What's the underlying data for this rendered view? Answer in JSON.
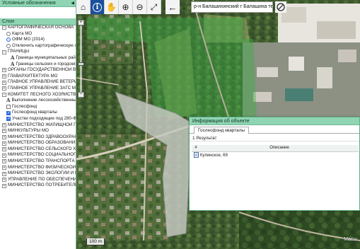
{
  "left_panel": {
    "title": "Условные обозначения",
    "layers_title": "Слои",
    "tree": [
      {
        "type": "group",
        "expand": "−",
        "label": "КАРТОГРАФИЧЕСКАЯ ОСНОВА",
        "indent": 1
      },
      {
        "type": "radio",
        "checked": false,
        "label": "Карта МО",
        "indent": 2
      },
      {
        "type": "radio",
        "checked": true,
        "label": "ОФМ МО (2014)",
        "indent": 2
      },
      {
        "type": "radio",
        "checked": false,
        "label": "Отключить картографическую осно",
        "indent": 2
      },
      {
        "type": "group",
        "expand": "−",
        "label": "ГРАНИЦЫ",
        "indent": 1
      },
      {
        "type": "legend",
        "label": "Границы муниципальных районо",
        "indent": 3
      },
      {
        "type": "legend",
        "label": "Границы сельских и городских по",
        "indent": 3
      },
      {
        "type": "group",
        "expand": "+",
        "label": "ОРГАНЫ ГОСУДАРСТВЕННОЙ ВЛАСТИ М",
        "indent": 1
      },
      {
        "type": "group",
        "expand": "+",
        "label": "ГЛАВАРХИТЕКТУРА МО",
        "indent": 1
      },
      {
        "type": "group",
        "expand": "+",
        "label": "ГЛАВНОЕ УПРАВЛЕНИЕ ВЕТЕРИНАРИИ",
        "indent": 1
      },
      {
        "type": "group",
        "expand": "+",
        "label": "ГЛАВНОЕ УПРАВЛЕНИЕ ЗАГС МО",
        "indent": 1
      },
      {
        "type": "group",
        "expand": "−",
        "label": "КОМИТЕТ ЛЕСНОГО ХОЗЯЙСТВА МО",
        "indent": 1
      },
      {
        "type": "legend",
        "label": "Выполнение лесохозяйственных",
        "indent": 2
      },
      {
        "type": "check",
        "checked": false,
        "label": "Гослесфонд",
        "indent": 2
      },
      {
        "type": "check",
        "checked": true,
        "label": "Гослесфонд кварталы",
        "indent": 2
      },
      {
        "type": "check",
        "checked": true,
        "label": "Участки подходящие под 280-ФЗ",
        "indent": 2
      },
      {
        "type": "group",
        "expand": "+",
        "label": "МИНИСТЕРСТВО ЖИЛИЩНОЙ ПОЛИТИКИ",
        "indent": 1
      },
      {
        "type": "group",
        "expand": "+",
        "label": "МИНКУЛЬТУРЫ МО",
        "indent": 1
      },
      {
        "type": "group",
        "expand": "+",
        "label": "МИНИСТЕРСТВО ЗДРАВООХРАНЕНИЯ М",
        "indent": 1
      },
      {
        "type": "group",
        "expand": "+",
        "label": "МИНИСТЕРСТВО ОБРАЗОВАНИЯ МО",
        "indent": 1
      },
      {
        "type": "group",
        "expand": "+",
        "label": "МИНИСТЕРСТВО СЕЛЬСКОГО ХОЗЯЙСТ",
        "indent": 1
      },
      {
        "type": "group",
        "expand": "+",
        "label": "МИНИСТЕРСТВО СОЦИАЛЬНОГО РАЗВИ",
        "indent": 1
      },
      {
        "type": "group",
        "expand": "+",
        "label": "МИНИСТЕРСТВО ТРАНСПОРТА И ДОРОЖ",
        "indent": 1
      },
      {
        "type": "group",
        "expand": "+",
        "label": "МИНИСТЕРСТВО ФИЗИЧЕСКОЙ КУЛЬТУ",
        "indent": 1
      },
      {
        "type": "group",
        "expand": "+",
        "label": "МИНИСТЕРСТВО ЭКОЛОГИИ И ПРИРОДО",
        "indent": 1
      },
      {
        "type": "group",
        "expand": "+",
        "label": "УПРАВЛЕНИЕ ПО ОБЕСПЕЧЕНИЮ ДЕЯТЕЛ",
        "indent": 1
      },
      {
        "type": "group",
        "expand": "+",
        "label": "МИНИСТЕРСТВО ПОТРЕБИТЕЛЬСКОГО РЫ",
        "indent": 1
      }
    ]
  },
  "toolbar": {
    "buttons": [
      {
        "name": "home",
        "glyph": "⌂",
        "active": false
      },
      {
        "name": "info",
        "glyph": "i",
        "active": true
      },
      {
        "name": "pan-hand",
        "glyph": "✋",
        "active": false
      },
      {
        "name": "zoom-in",
        "glyph": "⊕",
        "active": false
      },
      {
        "name": "zoom-out",
        "glyph": "⊖",
        "active": false
      },
      {
        "name": "full-extent",
        "glyph": "⤢",
        "active": false
      }
    ],
    "back_glyph": "←",
    "search_value": "р-н Балашихинский г Балашиха тер м",
    "clear_glyph": "⊘"
  },
  "info_window": {
    "title": "Информация об объекте",
    "tab": "Гослесфонд кварталы",
    "results": "1 Результат",
    "columns": [
      "#",
      "Описание"
    ],
    "rows": [
      {
        "num": "",
        "value": "Купинское, 69"
      }
    ]
  },
  "map": {
    "scale_label": "100 m",
    "attribution": "Масш"
  }
}
